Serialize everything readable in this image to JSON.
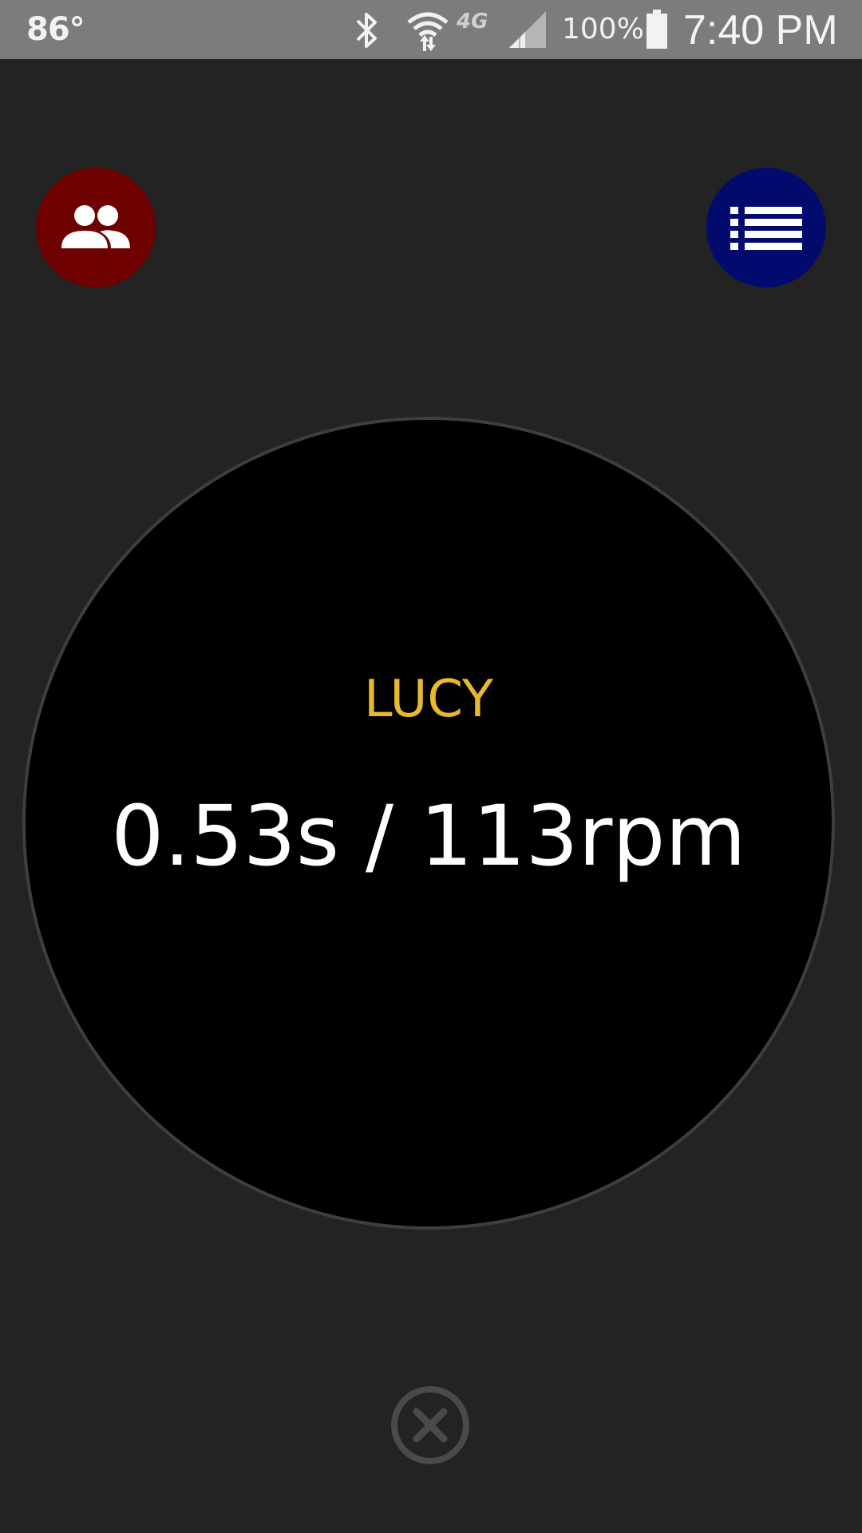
{
  "status_bar": {
    "temperature": "86°",
    "network": "4G",
    "battery_percent": "100%",
    "time": "7:40 PM",
    "icons": [
      "bluetooth-icon",
      "wifi-icon",
      "signal-icon",
      "battery-icon"
    ]
  },
  "toolbar": {
    "left_button_icon": "people-icon",
    "left_button_color": "#6e0000",
    "right_button_icon": "list-icon",
    "right_button_color": "#020a6e"
  },
  "timer": {
    "name": "LUCY",
    "name_color": "#e6b92e",
    "reading": "0.53s / 113rpm"
  },
  "close_button": {
    "icon": "close-icon"
  }
}
